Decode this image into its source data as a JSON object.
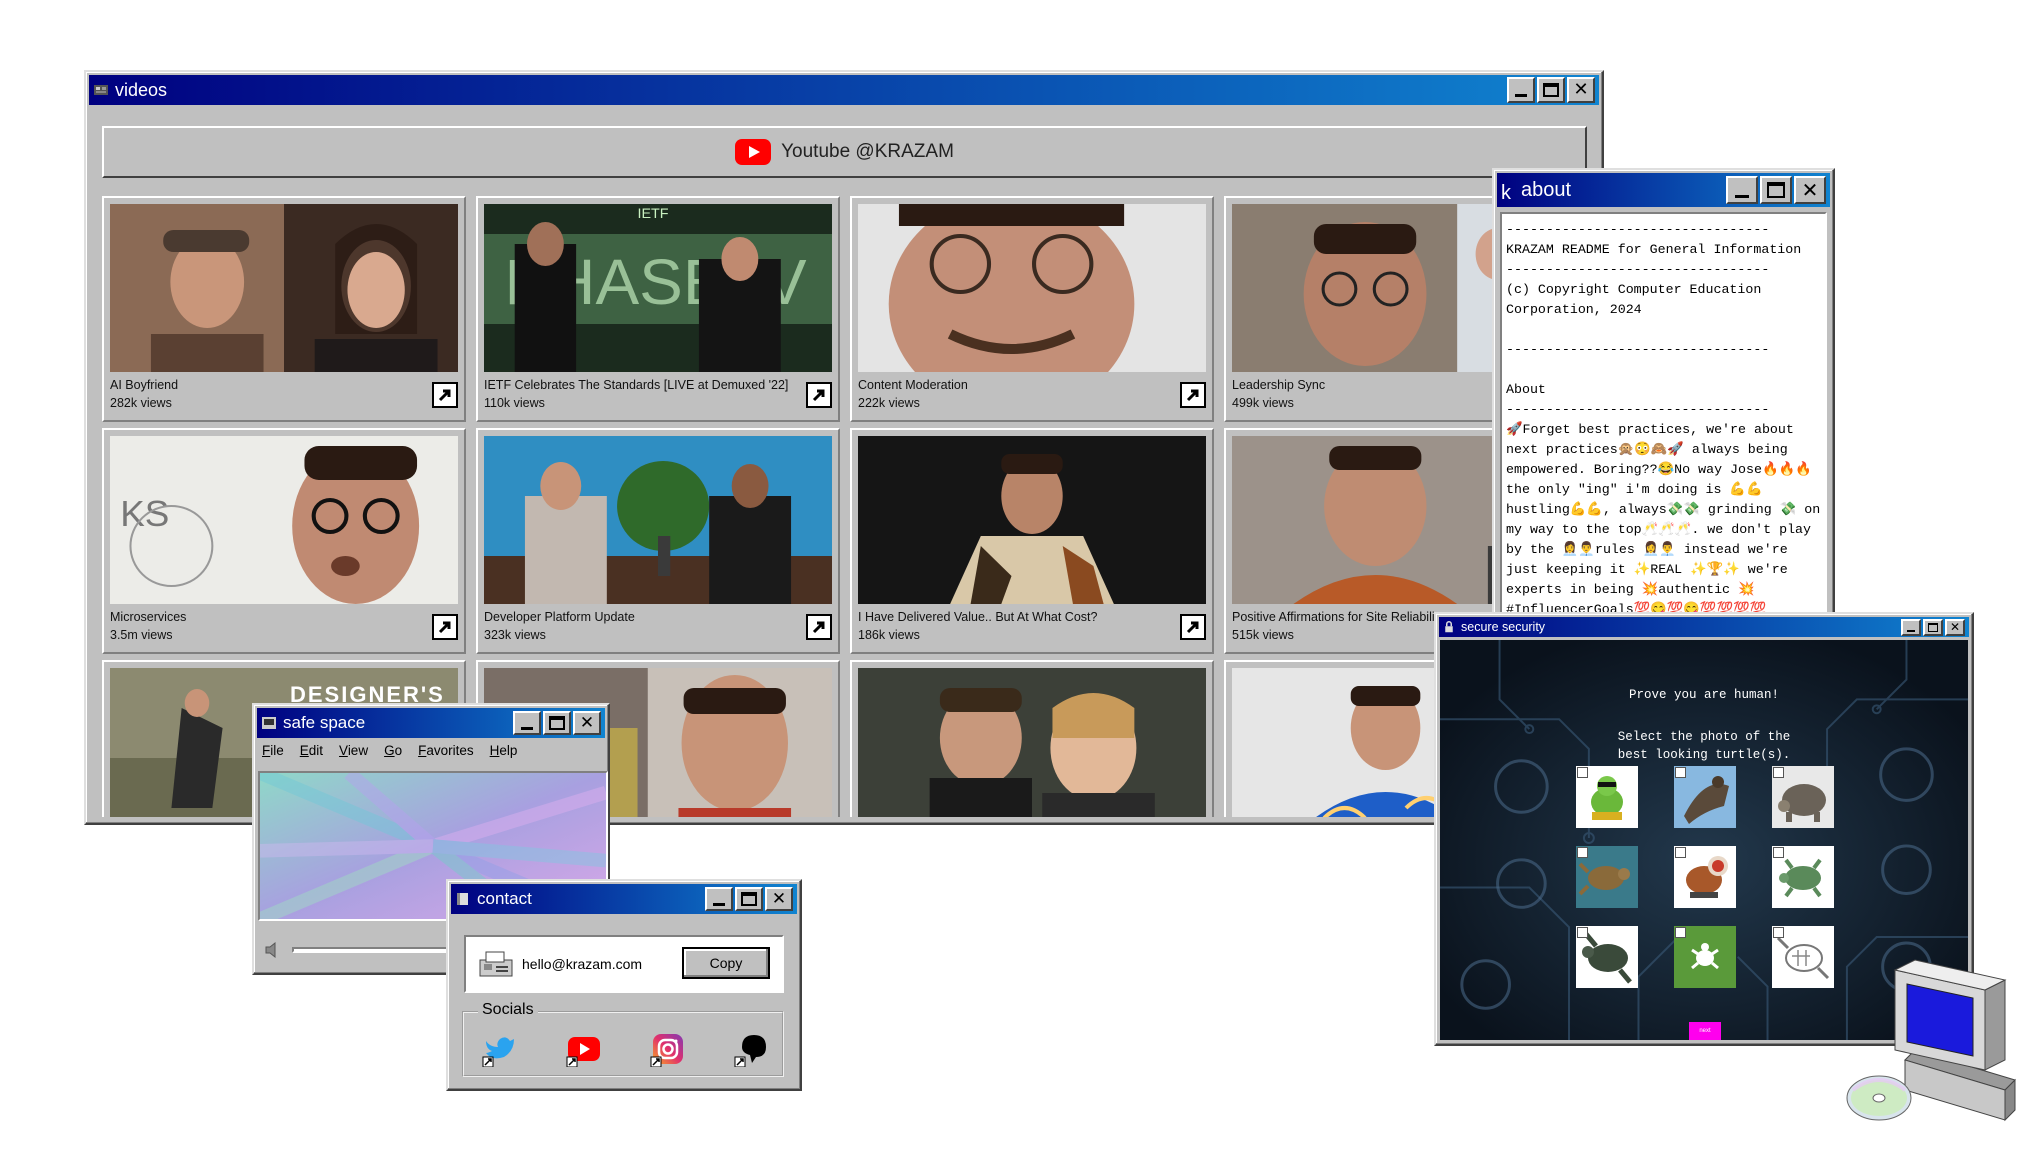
{
  "videos_window": {
    "title": "videos",
    "banner_label": "Youtube @KRAZAM",
    "videos": [
      {
        "title": "AI Boyfriend",
        "views": "282k views"
      },
      {
        "title": "IETF Celebrates The Standards [LIVE at Demuxed '22]",
        "views": "110k views"
      },
      {
        "title": "Content Moderation",
        "views": "222k views"
      },
      {
        "title": "Leadership Sync",
        "views": "499k views"
      },
      {
        "title": "Microservices",
        "views": "3.5m views"
      },
      {
        "title": "Developer Platform Update",
        "views": "323k views"
      },
      {
        "title": "I Have Delivered Value.. But At What Cost?",
        "views": "186k views"
      },
      {
        "title": "Positive Affirmations for Site Reliability",
        "views": "515k views"
      },
      {
        "title": "",
        "views": "",
        "overlay_text": "DESIGNER'S"
      },
      {
        "title": "",
        "views": ""
      },
      {
        "title": "",
        "views": ""
      },
      {
        "title": "",
        "views": ""
      }
    ]
  },
  "about_window": {
    "title": "about",
    "title_prefix": "k",
    "body": "---------------------------------\nKRAZAM README for General Information\n---------------------------------\n(c) Copyright Computer Education Corporation, 2024\n\n---------------------------------\n\nAbout\n---------------------------------\n🚀Forget best practices, we're about next practices🙊😳🙈🚀 always being empowered. Boring??😂No way Jose🔥🔥🔥 the only \"ing\" i'm doing is 💪💪 hustling💪💪, always💸💸 grinding 💸 on my way to the top🥂🥂🥂. we don't play by the 👩‍💼👨‍💼rules 👩‍💼👨‍💼 instead we're just keeping it ✨REAL ✨🏆✨ we're experts in being 💥authentic 💥 #InfluencerGoals💯😋💯😋💯💯💯💯  think outside the box📦 ? We don't even SEE the box"
  },
  "secure_window": {
    "title": "secure security",
    "heading": "Prove you are human!",
    "instruction_1": "Select the photo of the",
    "instruction_2": "best looking turtle(s).",
    "next_label": "next"
  },
  "safe_window": {
    "title": "safe space",
    "menu": [
      "File",
      "Edit",
      "View",
      "Go",
      "Favorites",
      "Help"
    ],
    "volume_level": 0.78
  },
  "contact_window": {
    "title": "contact",
    "email": "hello@krazam.com",
    "copy_label": "Copy",
    "socials_label": "Socials",
    "socials": [
      "twitter-icon",
      "youtube-icon",
      "instagram-icon",
      "threads-icon"
    ]
  },
  "colors": {
    "titlebar_start": "#000080",
    "titlebar_end": "#1084d0",
    "window_face": "#c0c0c0",
    "next_button": "#ff00ee",
    "youtube_red": "#ff0000"
  }
}
